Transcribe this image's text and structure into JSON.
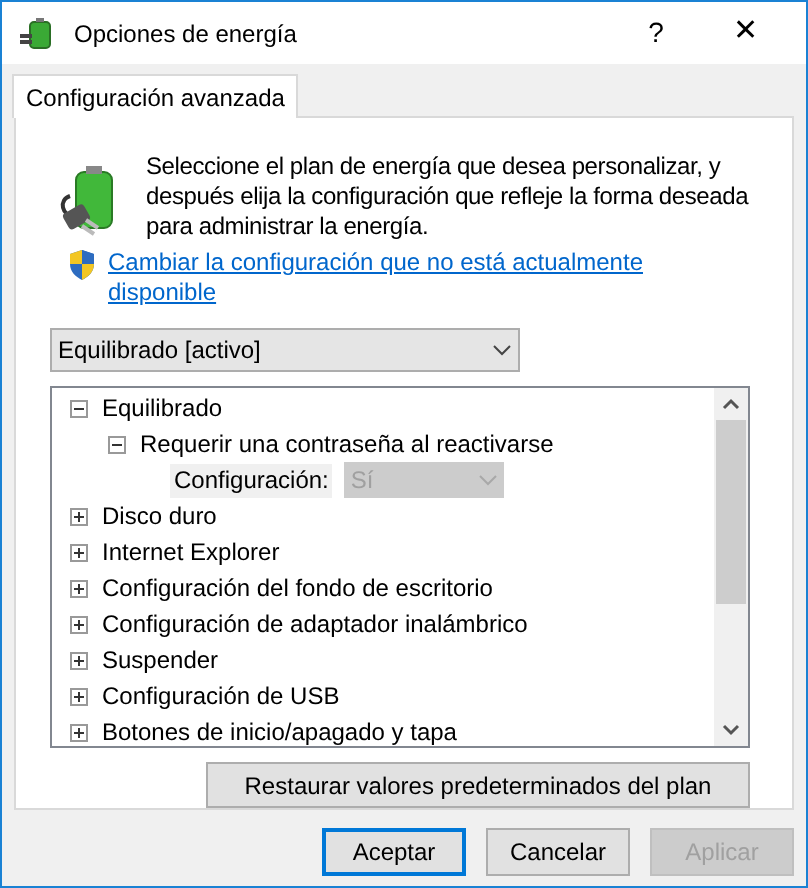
{
  "window": {
    "title": "Opciones de energía",
    "help": "?",
    "close": "✕"
  },
  "tabs": [
    {
      "label": "Configuración avanzada",
      "selected": true
    }
  ],
  "description": "Seleccione el plan de energía que desea personalizar, y después elija la configuración que refleje la forma deseada para administrar la energía.",
  "admin_link": "Cambiar la configuración que no está actualmente disponible",
  "plan_dropdown": {
    "value": "Equilibrado [activo]"
  },
  "tree": [
    {
      "kind": "node",
      "label": "Equilibrado",
      "expanded": true,
      "children": [
        {
          "kind": "node",
          "label": "Requerir una contraseña al reactivarse",
          "expanded": true,
          "children": [
            {
              "kind": "setting",
              "label": "Configuración:",
              "value": "Sí",
              "disabled": true
            }
          ]
        }
      ]
    },
    {
      "kind": "node",
      "label": "Disco duro",
      "expanded": false
    },
    {
      "kind": "node",
      "label": "Internet Explorer",
      "expanded": false
    },
    {
      "kind": "node",
      "label": "Configuración del fondo de escritorio",
      "expanded": false
    },
    {
      "kind": "node",
      "label": "Configuración de adaptador inalámbrico",
      "expanded": false
    },
    {
      "kind": "node",
      "label": "Suspender",
      "expanded": false
    },
    {
      "kind": "node",
      "label": "Configuración de USB",
      "expanded": false
    },
    {
      "kind": "node",
      "label": "Botones de inicio/apagado y tapa",
      "expanded": false
    }
  ],
  "restore_button": "Restaurar valores predeterminados del plan",
  "buttons": [
    {
      "label": "Aceptar",
      "default": true,
      "disabled": false
    },
    {
      "label": "Cancelar",
      "default": false,
      "disabled": false
    },
    {
      "label": "Aplicar",
      "default": false,
      "disabled": true
    }
  ]
}
